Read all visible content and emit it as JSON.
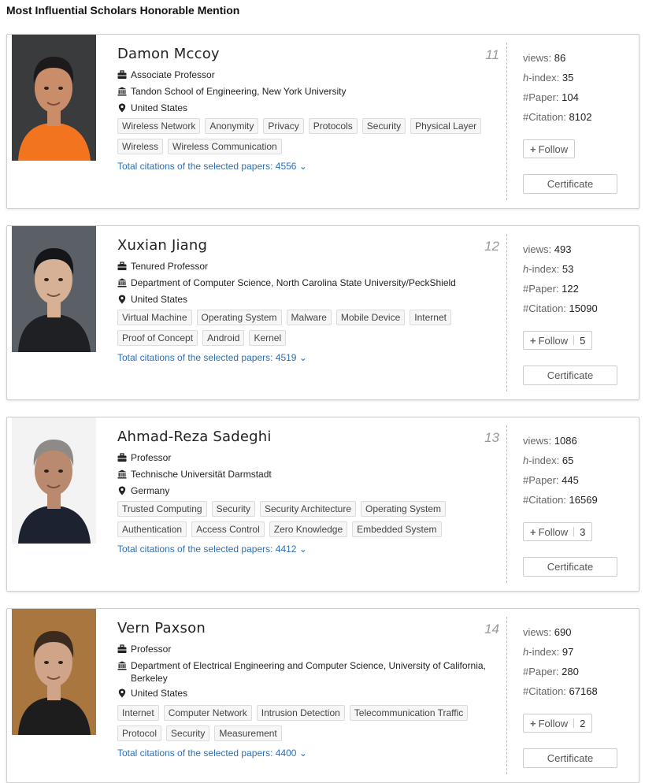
{
  "page_title": "Most Influential Scholars Honorable Mention",
  "scholars": [
    {
      "name": "Damon Mccoy",
      "rank": "11",
      "position": "Associate Professor",
      "affiliation": "Tandon School of Engineering, New York University",
      "location": "United States",
      "tags": [
        "Wireless Network",
        "Anonymity",
        "Privacy",
        "Protocols",
        "Security",
        "Physical Layer",
        "Wireless",
        "Wireless Communication"
      ],
      "citations_link": "Total citations of the selected papers: 4556 ⌄",
      "views": "86",
      "hindex": "35",
      "papers": "104",
      "citations": "8102",
      "follow_label": "Follow",
      "follow_count": "",
      "certificate_label": "Certificate"
    },
    {
      "name": "Xuxian Jiang",
      "rank": "12",
      "position": "Tenured Professor",
      "affiliation": "Department of Computer Science, North Carolina State University/PeckShield",
      "location": "United States",
      "tags": [
        "Virtual Machine",
        "Operating System",
        "Malware",
        "Mobile Device",
        "Internet",
        "Proof of Concept",
        "Android",
        "Kernel"
      ],
      "citations_link": "Total citations of the selected papers: 4519 ⌄",
      "views": "493",
      "hindex": "53",
      "papers": "122",
      "citations": "15090",
      "follow_label": "Follow",
      "follow_count": "5",
      "certificate_label": "Certificate"
    },
    {
      "name": "Ahmad-Reza Sadeghi",
      "rank": "13",
      "position": "Professor",
      "affiliation": "Technische Universität Darmstadt",
      "location": "Germany",
      "tags": [
        "Trusted Computing",
        "Security",
        "Security Architecture",
        "Operating System",
        "Authentication",
        "Access Control",
        "Zero Knowledge",
        "Embedded System"
      ],
      "citations_link": "Total citations of the selected papers: 4412 ⌄",
      "views": "1086",
      "hindex": "65",
      "papers": "445",
      "citations": "16569",
      "follow_label": "Follow",
      "follow_count": "3",
      "certificate_label": "Certificate"
    },
    {
      "name": "Vern Paxson",
      "rank": "14",
      "position": "Professor",
      "affiliation": "Department of Electrical Engineering and Computer Science, University of California, Berkeley",
      "location": "United States",
      "tags": [
        "Internet",
        "Computer Network",
        "Intrusion Detection",
        "Telecommunication Traffic",
        "Protocol",
        "Security",
        "Measurement"
      ],
      "citations_link": "Total citations of the selected papers: 4400 ⌄",
      "views": "690",
      "hindex": "97",
      "papers": "280",
      "citations": "67168",
      "follow_label": "Follow",
      "follow_count": "2",
      "certificate_label": "Certificate"
    }
  ],
  "stat_labels": {
    "views": "views:",
    "hindex": "h",
    "hindex_suffix": "-index:",
    "papers": "#Paper:",
    "citations": "#Citation:"
  },
  "avatars": [
    {
      "bg": "#3a3b3d",
      "shirt": "#f2741f",
      "skin": "#c98d6a",
      "hair": "#1c1a1a"
    },
    {
      "bg": "#5b5f66",
      "shirt": "#1f2024",
      "skin": "#d6b195",
      "hair": "#15161a"
    },
    {
      "bg": "#f3f3f3",
      "shirt": "#1c2230",
      "skin": "#b98a6e",
      "hair": "#8d8a88"
    },
    {
      "bg": "#a9763f",
      "shirt": "#1d1d1d",
      "skin": "#cfa488",
      "hair": "#3b2a1e"
    }
  ]
}
